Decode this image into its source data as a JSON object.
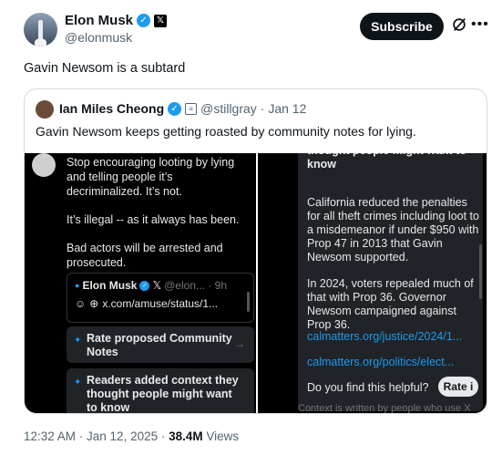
{
  "author": {
    "name": "Elon Musk",
    "handle": "@elonmusk",
    "x_badge": "𝕏"
  },
  "actions": {
    "subscribe_label": "Subscribe"
  },
  "tweet": {
    "text": "Gavin Newsom is a subtard",
    "time": "12:32 AM · Jan 12, 2025 · ",
    "views": "38.4M",
    "views_label": " Views"
  },
  "quote": {
    "name": "Ian Miles Cheong",
    "handle": "@stillgray",
    "date": "· Jan 12",
    "text": "Gavin Newsom keeps getting roasted by community notes for lying."
  },
  "left_pane": {
    "line1": "Stop encouraging looting by lying and telling people it’s decriminalized. It’s not.",
    "line2": "It’s illegal -- as it always has been.",
    "line3": "Bad actors will be arrested and prosecuted.",
    "embed_name": "Elon Musk",
    "embed_handle": "@elon... · 9h",
    "embed_link": "x.com/amuse/status/1...",
    "rate_label": "Rate proposed Community Notes",
    "readers_label": "Readers added context they thought people might want to know"
  },
  "right_pane": {
    "top_text": "thought people might want to know",
    "para1": "California reduced the penalties for all theft crimes including loot to a misdemeanor if under $950 with Prop 47 in 2013 that Gavin Newsom supported.",
    "para2": "In 2024, voters repealed much of that with Prop 36.  Governor Newsom campaigned against Prop 36.",
    "link1": "calmatters.org/justice/2024/1...",
    "link2": "calmatters.org/politics/elect...",
    "helpful": "Do you find this helpful?",
    "rate_btn": "Rate i",
    "footer": "Context is written by people who use X"
  },
  "colors": {
    "verified": "#1d9bf0",
    "text": "#0f1419",
    "muted": "#536471",
    "link": "#1d9bf0"
  }
}
